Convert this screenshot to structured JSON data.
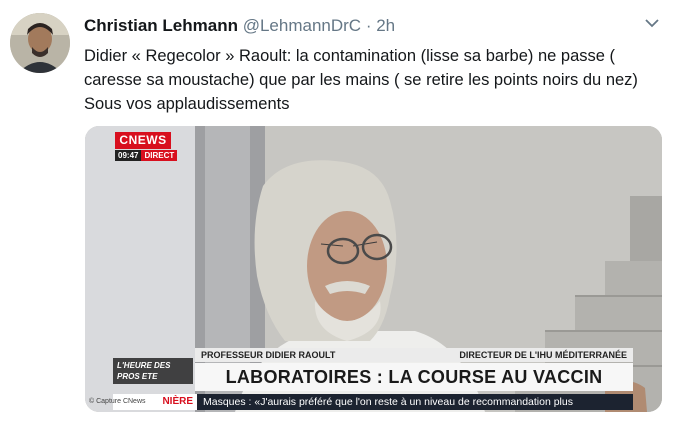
{
  "tweet": {
    "author_name": "Christian Lehmann",
    "handle": "@LehmannDrC",
    "separator": "·",
    "time": "2h",
    "text": "Didier « Regecolor » Raoult: la contamination (lisse sa barbe) ne passe ( caresse sa moustache) que par les mains ( se retire les points noirs du nez) Sous vos applaudissements",
    "menu_icon": "chevron-down-icon"
  },
  "media": {
    "channel_logo": "CNEWS",
    "clock": "09:47",
    "live_label": "DIRECT",
    "show_tag": "L'HEURE DES PROS ETE",
    "guest_name": "PROFESSEUR DIDIER RAOULT",
    "guest_title": "DIRECTEUR DE L'IHU MÉDITERRANÉE",
    "headline": "LABORATOIRES : LA COURSE AU VACCIN",
    "brand_strip": "NIÈRE",
    "credit": "© Capture CNews",
    "ticker": "Masques : «J'aurais préféré que l'on reste à un niveau de recommandation plus"
  },
  "colors": {
    "cnews_red": "#d80f1e",
    "ticker_bg": "#1c2330",
    "handle_gray": "#657786"
  }
}
